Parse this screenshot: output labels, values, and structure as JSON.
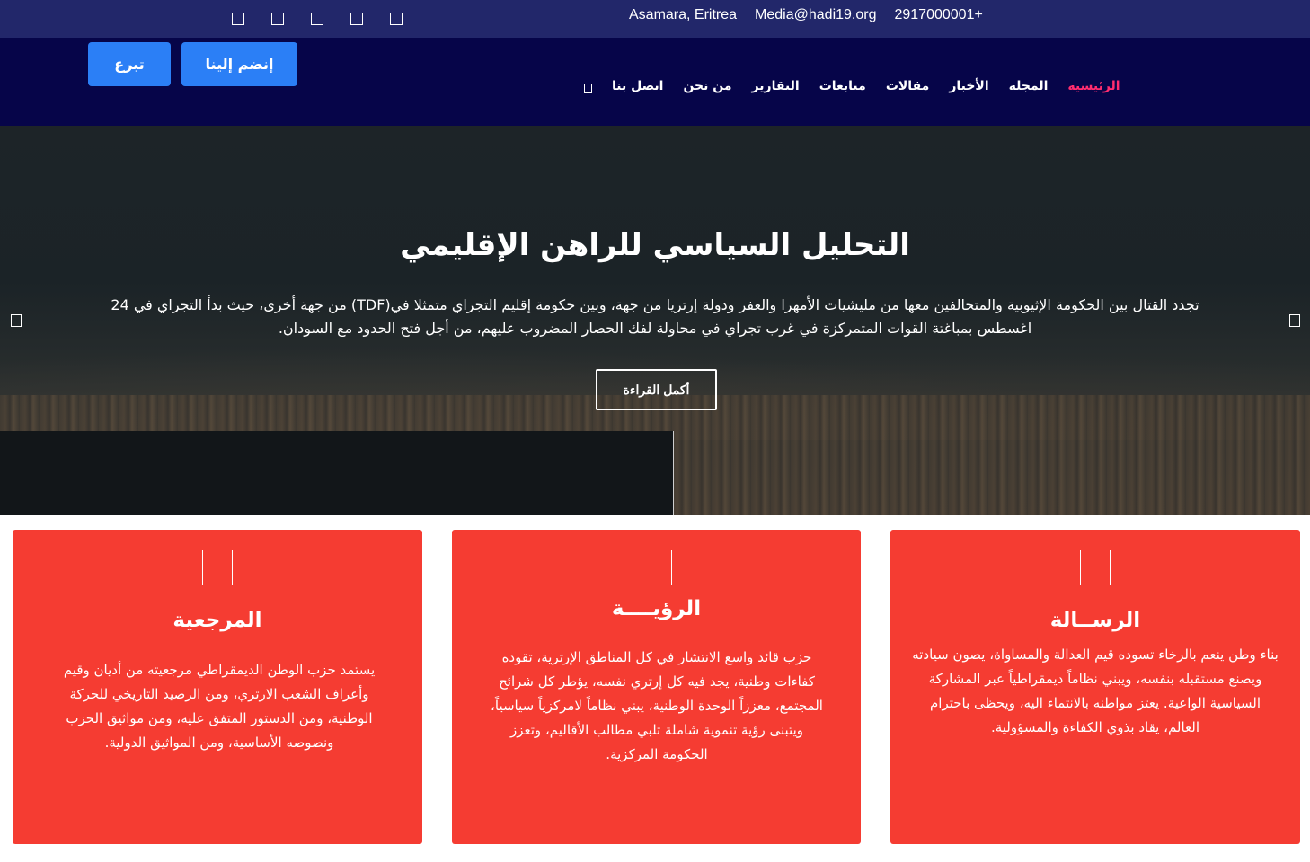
{
  "topbar": {
    "social_icons": [
      "social-icon-1",
      "social-icon-2",
      "social-icon-3",
      "social-icon-4",
      "social-icon-5"
    ],
    "location": "Asamara, Eritrea",
    "email": "Media@hadi19.org",
    "phone": "2917000001+"
  },
  "nav": {
    "items": [
      "الرئيسية",
      "المجلة",
      "الأخبار",
      "مقالات",
      "متابعات",
      "التقارير",
      "من نحن",
      "اتصل بنا"
    ],
    "join_label": "إنضم إلينا",
    "donate_label": "تبرع",
    "colors": {
      "background": "#060549",
      "active": "#ff2d6f",
      "button": "#2b7ff6"
    }
  },
  "hero": {
    "title": "التحليل السياسي للراهن الإقليمي",
    "text": "تجدد القتال بين الحكومة الإثيوبية والمتحالفين معها من مليشيات الأمهرا والعفر ودولة إرتريا من جهة، وبين حكومة إقليم التجراي متمثلا في(TDF) من جهة أخرى، حيث بدأ التجراي في 24 اغسطس بمباغتة القوات المتمركزة في غرب تجراي في محاولة لفك الحصار المضروب عليهم، من أجل فتح الحدود مع السودان.",
    "read_more": "أكمل القراءة"
  },
  "cards": [
    {
      "title": "المرجعية",
      "text": "يستمد حزب الوطن الديمقراطي مرجعيته من أديان وقيم وأعراف الشعب الارتري، ومن الرصيد التاريخي للحركة الوطنية، ومن الدستور المتفق عليه، ومن مواثيق الحزب ونصوصه الأساسية، ومن المواثيق الدولية."
    },
    {
      "title": "الرؤيــــة",
      "text": "حزب قائد واسع الانتشار في كل المناطق الإرترية، تقوده كفاءات وطنية، يجد فيه كل إرتري نفسه، يؤطر كل شرائح المجتمع، معززاً الوحدة الوطنية، يبني نظاماً لامركزياً سياسياً، ويتبنى رؤية تنموية شاملة تلبي مطالب الأقاليم، وتعزز الحكومة المركزية."
    },
    {
      "title": "الرســالة",
      "text": "بناء وطن ينعم بالرخاء تسوده قيم العدالة والمساواة، يصون سيادته ويصنع مستقبله بنفسه، ويبني نظاماً ديمقراطياً عبر المشاركة السياسية الواعية. يعتز مواطنه بالانتماء اليه، ويحظى باحترام العالم، يقاد بذوي الكفاءة والمسؤولية."
    }
  ],
  "colors": {
    "topbar": "#22276a",
    "card": "#f53c32"
  }
}
